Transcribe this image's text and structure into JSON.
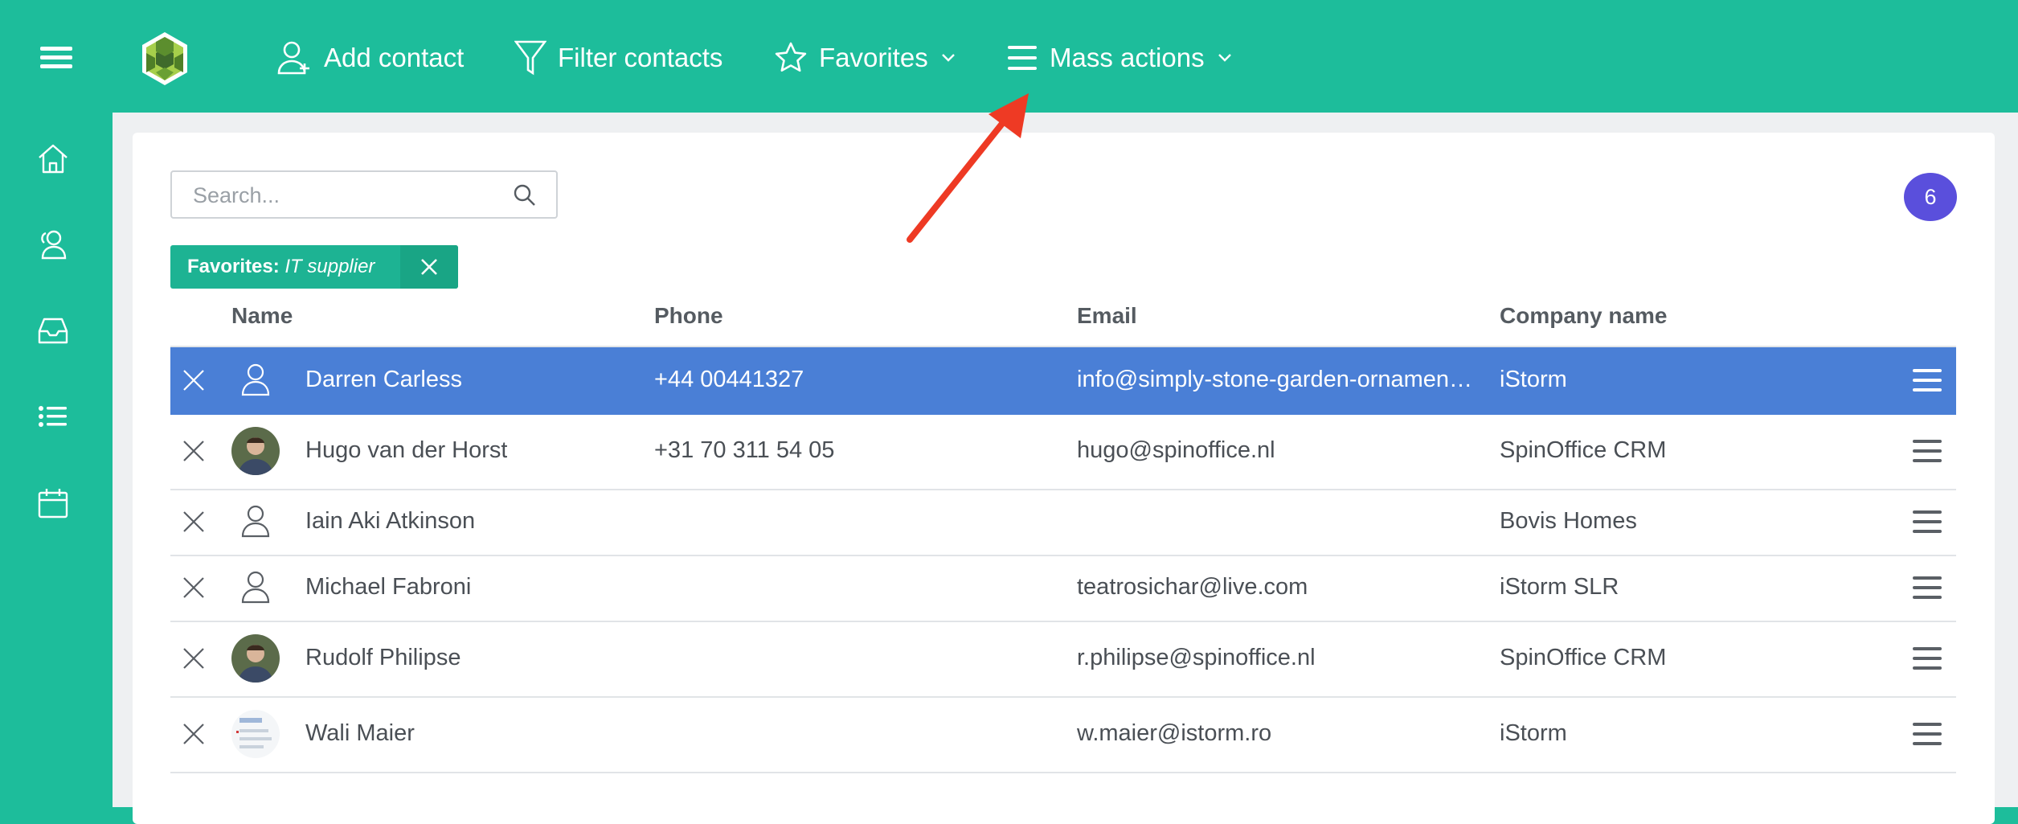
{
  "toolbar": {
    "add_contact": "Add contact",
    "filter_contacts": "Filter contacts",
    "favorites": "Favorites",
    "mass_actions": "Mass actions"
  },
  "sidebar": {
    "items": [
      {
        "icon": "home-icon"
      },
      {
        "icon": "contacts-icon"
      },
      {
        "icon": "inbox-icon"
      },
      {
        "icon": "list-icon"
      },
      {
        "icon": "calendar-icon"
      }
    ]
  },
  "search": {
    "placeholder": "Search..."
  },
  "filter_chip": {
    "label": "Favorites:",
    "value": "IT supplier"
  },
  "count_badge": "6",
  "table": {
    "headers": {
      "name": "Name",
      "phone": "Phone",
      "email": "Email",
      "company": "Company name"
    },
    "rows": [
      {
        "name": "Darren Carless",
        "phone": "+44 00441327",
        "email": "info@simply-stone-garden-ornaments.co.uk",
        "company": "iStorm",
        "avatar": "placeholder",
        "selected": true
      },
      {
        "name": "Hugo van der Horst",
        "phone": "+31 70 311 54 05",
        "email": "hugo@spinoffice.nl",
        "company": "SpinOffice CRM",
        "avatar": "photo"
      },
      {
        "name": "Iain Aki Atkinson",
        "phone": "",
        "email": "",
        "company": "Bovis Homes",
        "avatar": "placeholder"
      },
      {
        "name": "Michael Fabroni",
        "phone": "",
        "email": "teatrosichar@live.com",
        "company": "iStorm SLR",
        "avatar": "placeholder"
      },
      {
        "name": "Rudolf Philipse",
        "phone": "",
        "email": "r.philipse@spinoffice.nl",
        "company": "SpinOffice CRM",
        "avatar": "photo"
      },
      {
        "name": "Wali Maier",
        "phone": "",
        "email": "w.maier@istorm.ro",
        "company": "iStorm",
        "avatar": "screenshot"
      }
    ]
  },
  "colors": {
    "brand": "#1dbd9b",
    "selected_row": "#4a7fd6",
    "badge": "#5a4fdc",
    "annotation_arrow": "#ee3a24"
  }
}
